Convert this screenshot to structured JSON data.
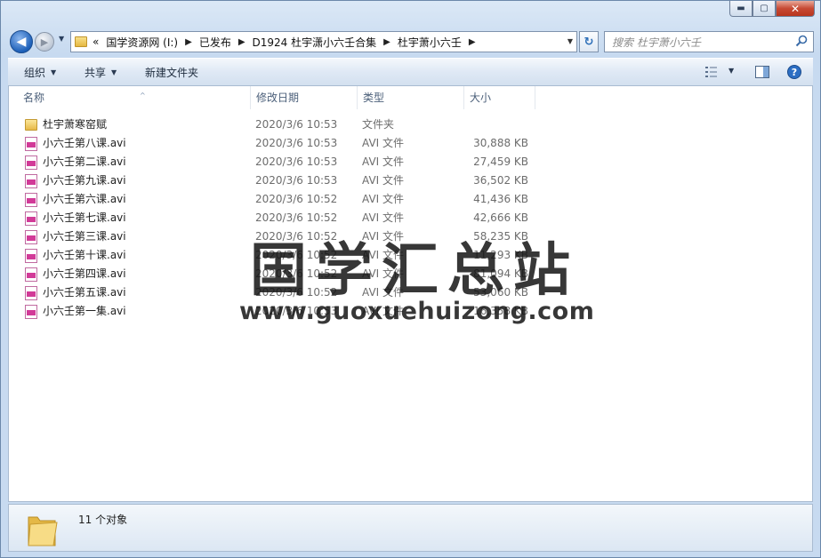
{
  "window": {
    "minimize_glyph": "▬",
    "maximize_glyph": "▢",
    "close_glyph": "✕"
  },
  "nav": {
    "back_glyph": "◀",
    "forward_glyph": "▶",
    "history_glyph": "▼",
    "breadcrumb_overflow": "«",
    "breadcrumbs": [
      "国学资源网 (I:)",
      "已发布",
      "D1924 杜宇潇小六壬合集",
      "杜宇萧小六壬"
    ],
    "separator": "▶",
    "refresh_glyph": "↻",
    "dropdown_glyph": "▼"
  },
  "search": {
    "placeholder": "搜索 杜宇萧小六壬"
  },
  "toolbar": {
    "organize_label": "组织",
    "share_label": "共享",
    "new_folder_label": "新建文件夹",
    "caret_glyph": "▼"
  },
  "columns": {
    "name": "名称",
    "date": "修改日期",
    "type": "类型",
    "size": "大小",
    "sort_glyph": "^"
  },
  "files": [
    {
      "name": "杜宇萧寒窑赋",
      "date": "2020/3/6 10:53",
      "type": "文件夹",
      "size": "",
      "kind": "folder"
    },
    {
      "name": "小六壬第八课.avi",
      "date": "2020/3/6 10:53",
      "type": "AVI 文件",
      "size": "30,888 KB",
      "kind": "avi"
    },
    {
      "name": "小六壬第二课.avi",
      "date": "2020/3/6 10:53",
      "type": "AVI 文件",
      "size": "27,459 KB",
      "kind": "avi"
    },
    {
      "name": "小六壬第九课.avi",
      "date": "2020/3/6 10:53",
      "type": "AVI 文件",
      "size": "36,502 KB",
      "kind": "avi"
    },
    {
      "name": "小六壬第六课.avi",
      "date": "2020/3/6 10:52",
      "type": "AVI 文件",
      "size": "41,436 KB",
      "kind": "avi"
    },
    {
      "name": "小六壬第七课.avi",
      "date": "2020/3/6 10:52",
      "type": "AVI 文件",
      "size": "42,666 KB",
      "kind": "avi"
    },
    {
      "name": "小六壬第三课.avi",
      "date": "2020/3/6 10:52",
      "type": "AVI 文件",
      "size": "58,235 KB",
      "kind": "avi"
    },
    {
      "name": "小六壬第十课.avi",
      "date": "2020/3/6 10:52",
      "type": "AVI 文件",
      "size": "11,293 KB",
      "kind": "avi"
    },
    {
      "name": "小六壬第四课.avi",
      "date": "2020/3/6 10:52",
      "type": "AVI 文件",
      "size": "81,094 KB",
      "kind": "avi"
    },
    {
      "name": "小六壬第五课.avi",
      "date": "2020/3/6 10:52",
      "type": "AVI 文件",
      "size": "53,060 KB",
      "kind": "avi"
    },
    {
      "name": "小六壬第一集.avi",
      "date": "2020/3/6 10:53",
      "type": "AVI 文件",
      "size": "16,358 KB",
      "kind": "avi"
    }
  ],
  "watermark": {
    "title": "国学汇总站",
    "url": "www.guoxuehuizong.com"
  },
  "details": {
    "count_text": "11 个对象"
  },
  "colors": {
    "window_frame": "#c7daf0",
    "address_border": "#7f93ad",
    "avi_icon": "#d23a98",
    "folder_icon": "#e7b946"
  }
}
